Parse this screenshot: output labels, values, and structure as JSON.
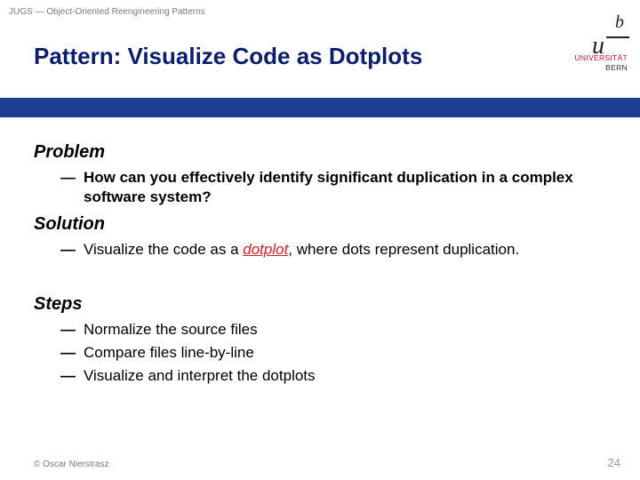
{
  "header": {
    "doc_tag": "JUGS — Object-Oriented Reengineering Patterns",
    "title": "Pattern: Visualize Code as Dotplots",
    "logo": {
      "u": "u",
      "b": "b",
      "uni_line1": "UNIVERSITÄT",
      "uni_line2": "BERN"
    }
  },
  "sections": {
    "problem": {
      "heading": "Problem",
      "items": [
        "How can you effectively identify significant duplication in a complex software system?"
      ]
    },
    "solution": {
      "heading": "Solution",
      "prefix": "Visualize the code as a ",
      "keyword": "dotplot",
      "suffix": ", where dots represent duplication."
    },
    "steps": {
      "heading": "Steps",
      "items": [
        "Normalize the source files",
        "Compare files line-by-line",
        "Visualize and interpret the dotplots"
      ]
    }
  },
  "footer": {
    "copyright": "© Oscar Nierstrasz",
    "page": "24"
  }
}
